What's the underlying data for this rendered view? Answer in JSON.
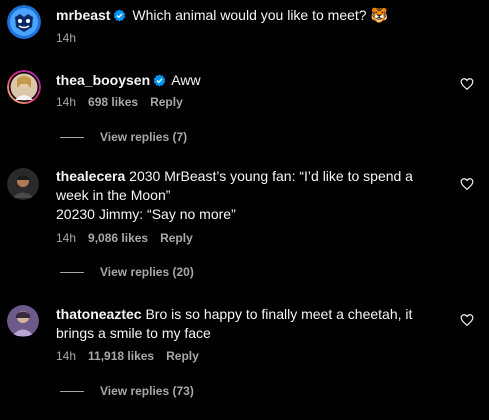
{
  "caption": {
    "username": "mrbeast",
    "text": "Which animal would you like to meet?",
    "emoji": "🐯",
    "time": "14h"
  },
  "comments": [
    {
      "username": "thea_booysen",
      "verified": true,
      "text": "Aww",
      "time": "14h",
      "likes": "698 likes",
      "reply_label": "Reply",
      "view_replies": "View replies (7)"
    },
    {
      "username": "thealecera",
      "verified": false,
      "text": "2030 MrBeast’s young fan: “I’d like to spend a week in the Moon”",
      "text2": "20230 Jimmy: “Say no more”",
      "time": "14h",
      "likes": "9,086 likes",
      "reply_label": "Reply",
      "view_replies": "View replies (20)"
    },
    {
      "username": "thatoneaztec",
      "verified": false,
      "text": "Bro is so happy to finally meet a cheetah, it brings a smile to my face",
      "time": "14h",
      "likes": "11,918 likes",
      "reply_label": "Reply",
      "view_replies": "View replies (73)"
    }
  ],
  "colors": {
    "background": "#000000",
    "text": "#f5f5f5",
    "secondary": "#a8a8a8",
    "verified": "#0095f6"
  },
  "icons": [
    "verified-badge-icon",
    "heart-icon"
  ]
}
